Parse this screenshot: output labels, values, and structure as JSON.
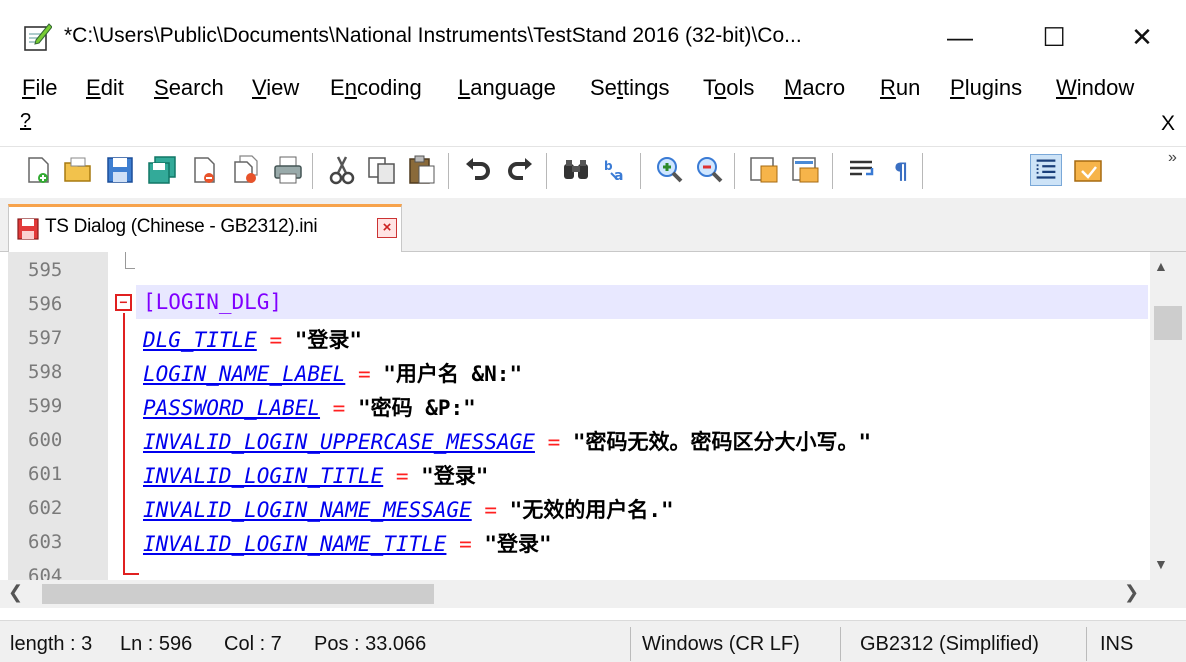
{
  "window": {
    "title": "*C:\\Users\\Public\\Documents\\National Instruments\\TestStand 2016 (32-bit)\\Co...",
    "minimize_glyph": "—",
    "maximize_glyph": "☐",
    "close_glyph": "✕"
  },
  "menubar": {
    "items": [
      {
        "first": "F",
        "rest": "ile"
      },
      {
        "first": "E",
        "rest": "dit"
      },
      {
        "first": "S",
        "rest": "earch"
      },
      {
        "first": "V",
        "rest": "iew"
      },
      {
        "first": "",
        "pre": "E",
        "u": "n",
        "post": "coding"
      },
      {
        "first": "L",
        "rest": "anguage"
      },
      {
        "pre": "Se",
        "u": "t",
        "post": "tings"
      },
      {
        "pre": "T",
        "u": "o",
        "post": "ols"
      },
      {
        "first": "M",
        "rest": "acro"
      },
      {
        "first": "R",
        "rest": "un"
      },
      {
        "first": "P",
        "rest": "lugins"
      },
      {
        "first": "W",
        "rest": "indow"
      }
    ],
    "help": "?",
    "close_doc": "X"
  },
  "toolbar": {
    "icons": [
      "new-file-icon",
      "open-file-icon",
      "save-icon",
      "save-all-icon",
      "close-icon",
      "close-all-icon",
      "print-icon",
      "cut-icon",
      "copy-icon",
      "paste-icon",
      "undo-icon",
      "redo-icon",
      "find-icon",
      "replace-icon",
      "zoom-in-icon",
      "zoom-out-icon",
      "sync-vertical-icon",
      "sync-horizontal-icon",
      "word-wrap-icon",
      "show-all-characters-icon",
      "indent-guide-icon",
      "folder-as-workspace-icon"
    ],
    "more": "»"
  },
  "tab": {
    "label": "TS Dialog (Chinese - GB2312).ini",
    "close_glyph": "×"
  },
  "editor": {
    "line_numbers": [
      "595",
      "596",
      "597",
      "598",
      "599",
      "600",
      "601",
      "602",
      "603",
      "604"
    ],
    "section": "[LOGIN_DLG]",
    "lines": [
      {
        "key": "DLG_TITLE",
        "op": " = ",
        "value": "\"登录\""
      },
      {
        "key": "LOGIN_NAME_LABEL",
        "op": " = ",
        "value": "\"用户名 &N:\""
      },
      {
        "key": "PASSWORD_LABEL",
        "op": " = ",
        "value": "\"密码 &P:\""
      },
      {
        "key": "INVALID_LOGIN_UPPERCASE_MESSAGE",
        "op": " = ",
        "value": "\"密码无效。密码区分大小写。\""
      },
      {
        "key": "INVALID_LOGIN_TITLE",
        "op": " = ",
        "value": "\"登录\""
      },
      {
        "key": "INVALID_LOGIN_NAME_MESSAGE",
        "op": " = ",
        "value": "\"无效的用户名.\""
      },
      {
        "key": "INVALID_LOGIN_NAME_TITLE",
        "op": " = ",
        "value": "\"登录\""
      }
    ],
    "fold_glyph": "−"
  },
  "statusbar": {
    "length": "length : 3",
    "ln": "Ln : 596",
    "col": "Col : 7",
    "pos": "Pos : 33.066",
    "eol": "Windows (CR LF)",
    "encoding": "GB2312 (Simplified)",
    "mode": "INS"
  },
  "scroll": {
    "up": "▲",
    "down": "▼",
    "left": "❮",
    "right": "❯"
  }
}
